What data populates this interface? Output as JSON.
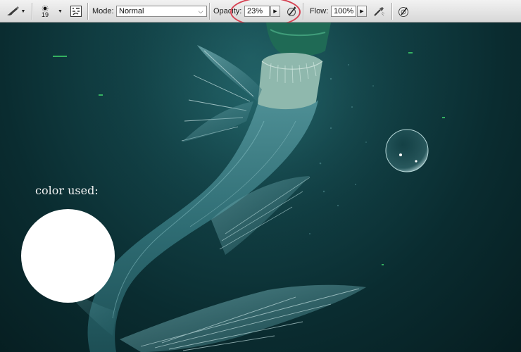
{
  "toolbar": {
    "brush_size": "19",
    "mode_label": "Mode:",
    "mode_value": "Normal",
    "opacity_label": "Opacity:",
    "opacity_value": "23%",
    "flow_label": "Flow:",
    "flow_value": "100%"
  },
  "canvas": {
    "caption": "color used:",
    "swatch_color": "#ffffff"
  },
  "icons": [
    "brush-tool-icon",
    "brush-picker-icon",
    "brush-panel-icon",
    "tablet-pressure-opacity-icon",
    "airbrush-icon",
    "tablet-pressure-size-icon"
  ],
  "colors": {
    "highlight": "#d64152",
    "canvas_bg": "#0c3236"
  }
}
